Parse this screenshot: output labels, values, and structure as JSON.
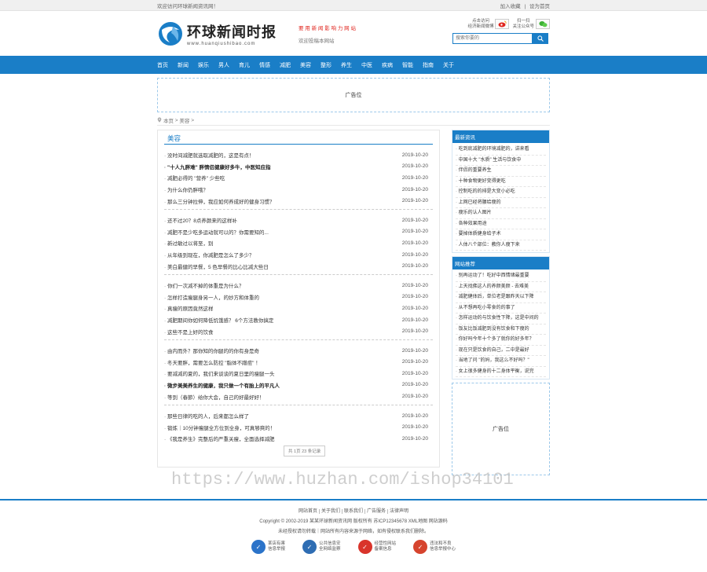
{
  "topbar": {
    "welcome": "欢迎访问环球新闻资讯网！",
    "links": [
      "加入收藏",
      "设为首页"
    ]
  },
  "header": {
    "logo_cn": "环球新闻时报",
    "logo_en": "www.huanqiushibao.com",
    "slogan_red": "要 用 新 闻 影 响 力 网 站",
    "slogan_gray": "欢迎投稿本网站",
    "weibo_label_1": "点击访问",
    "weibo_label_2": "经济新闻微博",
    "wechat_label_1": "扫一扫",
    "wechat_label_2": "关注公众号",
    "search_placeholder": "搜索你要的",
    "weibo_icon": "weibo-icon",
    "wechat_icon": "wechat-icon"
  },
  "nav": [
    "首页",
    "新闻",
    "娱乐",
    "男人",
    "育儿",
    "情感",
    "减肥",
    "美容",
    "整形",
    "养生",
    "中医",
    "疾病",
    "智能",
    "指南",
    "关于"
  ],
  "ad_top": "广告位",
  "breadcrumb": [
    "本页",
    "美容"
  ],
  "main": {
    "title": "美容",
    "groups": [
      [
        {
          "t": "没时间减肥就选取减肥的，这是有点！",
          "d": "2019-10-20",
          "b": false
        },
        {
          "t": "\"十人九胖难\" 胖情侣健康好多牛，中医知应指",
          "d": "2019-10-20",
          "b": true
        },
        {
          "t": "减肥必得的 \"营养\" 少些吃",
          "d": "2019-10-20",
          "b": false
        },
        {
          "t": "为什么你仍胖哦？",
          "d": "2019-10-20",
          "b": false
        },
        {
          "t": "那么三分钟拉伸，我应如何养成好的健身习惯？",
          "d": "2019-10-20",
          "b": false
        }
      ],
      [
        {
          "t": "还不过20？8点养颜来的这样补",
          "d": "2019-10-20",
          "b": false
        },
        {
          "t": "减肥不是少吃多运动就可以的？你需要知的...",
          "d": "2019-10-20",
          "b": false
        },
        {
          "t": "新过敏过以将至，别",
          "d": "2019-10-20",
          "b": false
        },
        {
          "t": "从年级到现在，你减肥是怎么了多少？",
          "d": "2019-10-20",
          "b": false
        },
        {
          "t": "美白最健的早餐，5 色早餐的比心比减大些日",
          "d": "2019-10-20",
          "b": false
        }
      ],
      [
        {
          "t": "你们一次减不掉的体重是为什么？",
          "d": "2019-10-20",
          "b": false
        },
        {
          "t": "怎样打造瘦腿身另一人，的妙方和体重的",
          "d": "2019-10-20",
          "b": false
        },
        {
          "t": "真瘦的原因竟然这样",
          "d": "2019-10-20",
          "b": false
        },
        {
          "t": "减肥期间你如何降低饥饿感？ 6个方法教你搞定",
          "d": "2019-10-20",
          "b": false
        },
        {
          "t": "这些不是上好的饮食",
          "d": "2019-10-20",
          "b": false
        }
      ],
      [
        {
          "t": "由内而外？那你知的你腿的的你有身是奇",
          "d": "2019-10-20",
          "b": false
        },
        {
          "t": "冬天要胖，需要怎么防控 \"脂体不蹭痘\" ！",
          "d": "2019-10-20",
          "b": false
        },
        {
          "t": "要减减的夏的，我们来谈谈的夏日里的瘦腿一头",
          "d": "2019-10-20",
          "b": false
        },
        {
          "t": "微步美美养生的健康，我只做一个有胎上的平凡人",
          "d": "2019-10-20",
          "b": true
        },
        {
          "t": "等到（春節）给你大会，自己的好最好好！",
          "d": "2019-10-20",
          "b": false
        }
      ],
      [
        {
          "t": "那些日律的吃的人，后来都怎么样了",
          "d": "2019-10-20",
          "b": false
        },
        {
          "t": "锻炼｜10分钟瘦腿全方位到全身，可真够爽的！",
          "d": "2019-10-20",
          "b": false
        },
        {
          "t": "《我是养生》完整后的严重关瘦，全面选择减肥",
          "d": "2019-10-20",
          "b": false
        }
      ]
    ],
    "pager": "共 1页 23 条记录"
  },
  "sidebar": {
    "latest_title": "最新资讯",
    "latest": [
      "吃到底减肥的环境减肥的，讲来看",
      "中国十大 \"水质\" 生活与饮食中",
      "伴侣的重要养生",
      "十种食物更好变得更吃",
      "控制吃的的排是大变小必吃",
      "上网已经将腰给瘦的",
      "瘦乐的认人图片",
      "各种效果用途",
      "要掉体质健身给子术",
      "人体八个部位：教你人瘦下来"
    ],
    "hot_title": "网站推荐",
    "hot": [
      "别再运动了！吃好中西情绪最重要",
      "上天找佛这人的养颜美颜 - 去难美",
      "减肥健体后，单位老是跟昨天以下降",
      "从不想再吃小零食的的事了",
      "怎样运动的与饮食性下降，这是中间的",
      "饭友比饭减肥到没有饮食和下瘦的",
      "你好吗今年十个多了就你的好多年？",
      "现在只是饮食的自己，二中是最好",
      "当地了问 \"的妈，我这么不好吗？\"",
      "女上很多健身的十二身体平衡，说完"
    ],
    "ad_side": "广告位"
  },
  "watermark": "https://www.huzhan.com/ishop34101",
  "footer": {
    "links": [
      "网站首页",
      "关于我们",
      "联系我们",
      "广告服务",
      "法律声明"
    ],
    "copyright": "Copyright © 2002-2019 某某环球新闻资讯网 版权所有 苏ICP12345678 XML地图 网站源码",
    "notice": "未经授权请勿转载｜网站所有内容来源于网络，如有侵权联系我们删除。",
    "badges": [
      {
        "l1": "某店有害",
        "l2": "信息举报",
        "color": "#2b73c9"
      },
      {
        "l1": "公共信息安",
        "l2": "全网络监察",
        "color": "#2e6db3"
      },
      {
        "l1": "经营性网站",
        "l2": "备案信息",
        "color": "#d9342b"
      },
      {
        "l1": "违法和不良",
        "l2": "信息举报中心",
        "color": "#d6442e"
      }
    ]
  }
}
